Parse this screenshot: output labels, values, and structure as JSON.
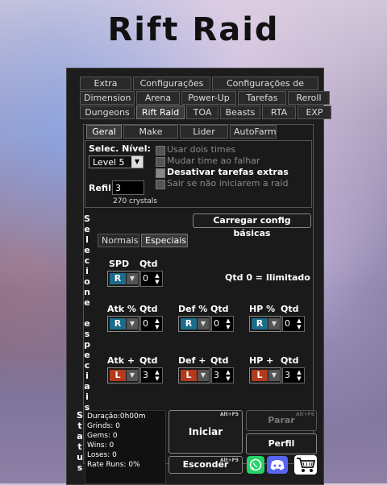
{
  "app_title": "Rift Raid",
  "tabs": {
    "row1": [
      "Extra",
      "Configurações",
      "Configurações de Filtro"
    ],
    "row2": [
      "Dimension",
      "Arena",
      "Power-Up",
      "Tarefas",
      "Reroll"
    ],
    "row3": [
      "Dungeons",
      "Rift Raid",
      "TOA",
      "Beasts",
      "RTA",
      "EXP"
    ]
  },
  "subtabs": [
    "Geral",
    "Make Party",
    "Lider Skill",
    "AutoFarm"
  ],
  "level": {
    "label": "Selec. Nível:",
    "value": "Level 5"
  },
  "checkboxes": [
    {
      "label": "Usar dois times",
      "enabled": false
    },
    {
      "label": "Mudar time ao falhar",
      "enabled": false
    },
    {
      "label": "Desativar tarefas extras",
      "enabled": true
    },
    {
      "label": "Sair se não iniciarem a raid",
      "enabled": false
    }
  ],
  "refil": {
    "label": "Refil",
    "value": "3",
    "crystals": "270 crystals"
  },
  "vertical_label": "Selecione especiais",
  "load_button": "Carregar config básicas",
  "rune_tabs": [
    "Normais",
    "Especiais"
  ],
  "spd": {
    "label": "SPD",
    "qtd_label": "Qtd",
    "rune": "R",
    "qty": "0"
  },
  "unlimited_note": "Qtd 0 = Ilimitado",
  "percent_row": [
    {
      "label": "Atk %",
      "qtd_label": "Qtd",
      "rune": "R",
      "qty": "0"
    },
    {
      "label": "Def %",
      "qtd_label": "Qtd",
      "rune": "R",
      "qty": "0"
    },
    {
      "label": "HP %",
      "qtd_label": "Qtd",
      "rune": "R",
      "qty": "0"
    }
  ],
  "flat_row": [
    {
      "label": "Atk +",
      "qtd_label": "Qtd",
      "rune": "L",
      "qty": "3"
    },
    {
      "label": "Def +",
      "qtd_label": "Qtd",
      "rune": "L",
      "qty": "3"
    },
    {
      "label": "HP +",
      "qtd_label": "Qtd",
      "rune": "L",
      "qty": "3"
    }
  ],
  "status_label": "Status",
  "status": {
    "duration": "Duração:0h00m",
    "grinds": "Grinds: 0",
    "gems": "Gems: 0",
    "wins": "Wins: 0",
    "loses": "Loses: 0",
    "rate": "Rate Runs: 0%"
  },
  "buttons": {
    "start": "Iniciar",
    "start_hotkey": "Alt+F5",
    "stop": "Parar",
    "stop_hotkey": "Alt+F6",
    "profile": "Perfil",
    "hide": "Esconder",
    "hide_hotkey": "Alt+F9"
  },
  "icons": [
    "whatsapp-icon",
    "discord-icon",
    "cart-icon"
  ],
  "colors": {
    "rune_blue": "#1c6d8c",
    "rune_red": "#b33a1c",
    "panel": "#1d1d1d"
  }
}
